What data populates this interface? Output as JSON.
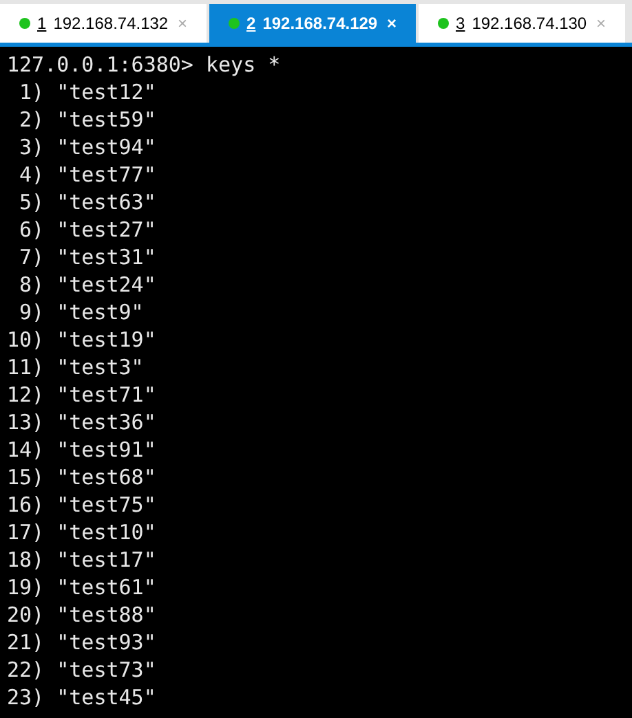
{
  "tabs": [
    {
      "number": "1",
      "label": "192.168.74.132",
      "selected": false,
      "close": "×"
    },
    {
      "number": "2",
      "label": "192.168.74.129",
      "selected": true,
      "close": "×"
    },
    {
      "number": "3",
      "label": "192.168.74.130",
      "selected": false,
      "close": "×"
    }
  ],
  "terminal": {
    "prompt": "127.0.0.1:6380> keys *",
    "lines": [
      " 1) \"test12\"",
      " 2) \"test59\"",
      " 3) \"test94\"",
      " 4) \"test77\"",
      " 5) \"test63\"",
      " 6) \"test27\"",
      " 7) \"test31\"",
      " 8) \"test24\"",
      " 9) \"test9\"",
      "10) \"test19\"",
      "11) \"test3\"",
      "12) \"test71\"",
      "13) \"test36\"",
      "14) \"test91\"",
      "15) \"test68\"",
      "16) \"test75\"",
      "17) \"test10\"",
      "18) \"test17\"",
      "19) \"test61\"",
      "20) \"test88\"",
      "21) \"test93\"",
      "22) \"test73\"",
      "23) \"test45\""
    ]
  }
}
